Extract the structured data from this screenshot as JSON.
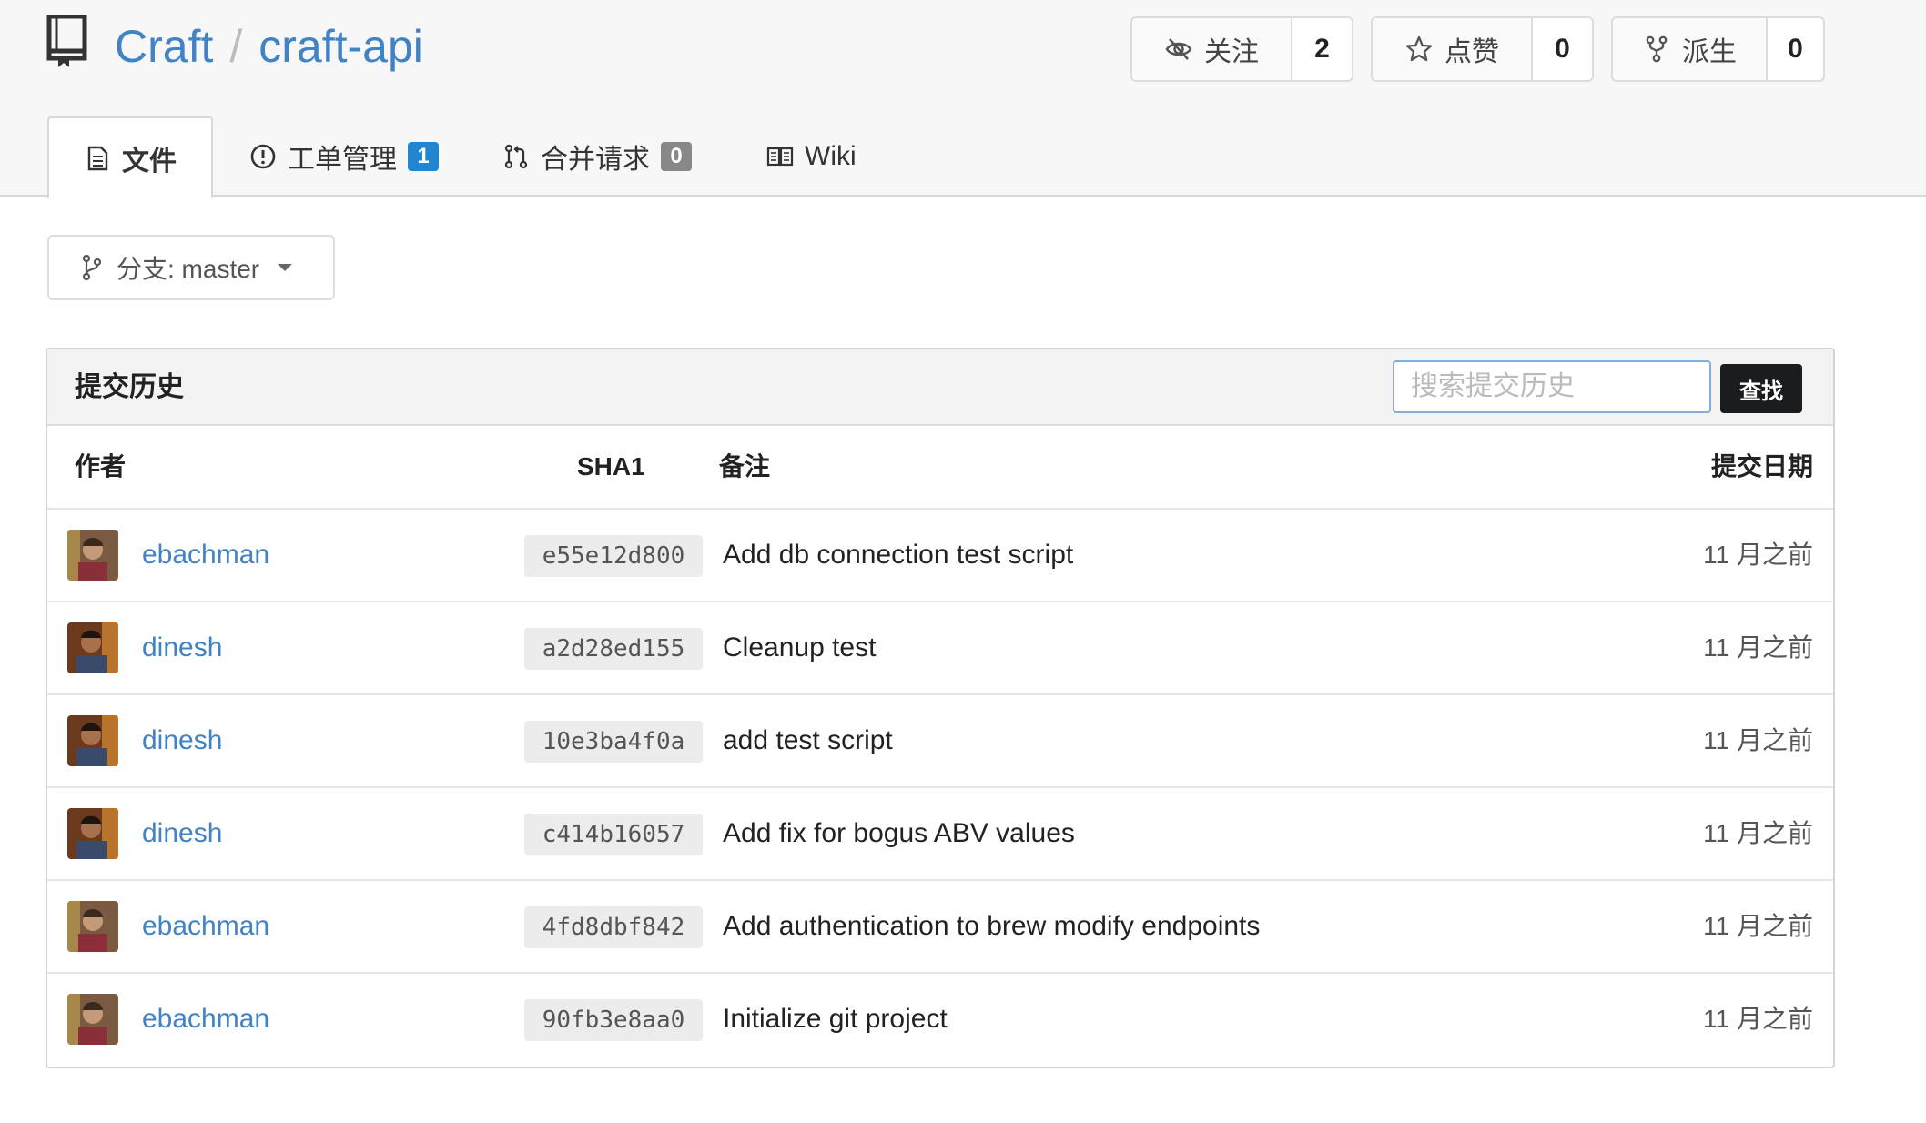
{
  "repo": {
    "owner": "Craft",
    "separator": "/",
    "name": "craft-api"
  },
  "actions": {
    "watch": {
      "label": "关注",
      "count": "2"
    },
    "star": {
      "label": "点赞",
      "count": "0"
    },
    "fork": {
      "label": "派生",
      "count": "0"
    }
  },
  "tabs": [
    {
      "label": "文件"
    },
    {
      "label": "工单管理",
      "badge": "1",
      "badge_color": "#2185d0"
    },
    {
      "label": "合并请求",
      "badge": "0",
      "badge_color": "#888888"
    },
    {
      "label": "Wiki"
    }
  ],
  "branch": {
    "label": "分支: master"
  },
  "history": {
    "title": "提交历史",
    "search_placeholder": "搜索提交历史",
    "search_button": "查找",
    "columns": {
      "author": "作者",
      "sha": "SHA1",
      "message": "备注",
      "date": "提交日期"
    },
    "commits": [
      {
        "author": "ebachman",
        "sha": "e55e12d800",
        "message": "Add db connection test script",
        "date": "11 月之前"
      },
      {
        "author": "dinesh",
        "sha": "a2d28ed155",
        "message": "Cleanup test",
        "date": "11 月之前"
      },
      {
        "author": "dinesh",
        "sha": "10e3ba4f0a",
        "message": "add test script",
        "date": "11 月之前"
      },
      {
        "author": "dinesh",
        "sha": "c414b16057",
        "message": "Add fix for bogus ABV values",
        "date": "11 月之前"
      },
      {
        "author": "ebachman",
        "sha": "4fd8dbf842",
        "message": "Add authentication to brew modify endpoints",
        "date": "11 月之前"
      },
      {
        "author": "ebachman",
        "sha": "90fb3e8aa0",
        "message": "Initialize git project",
        "date": "11 月之前"
      }
    ]
  },
  "colors": {
    "link": "#4183c4",
    "primary_badge": "#2185d0",
    "search_button": "#1b1c1d"
  }
}
